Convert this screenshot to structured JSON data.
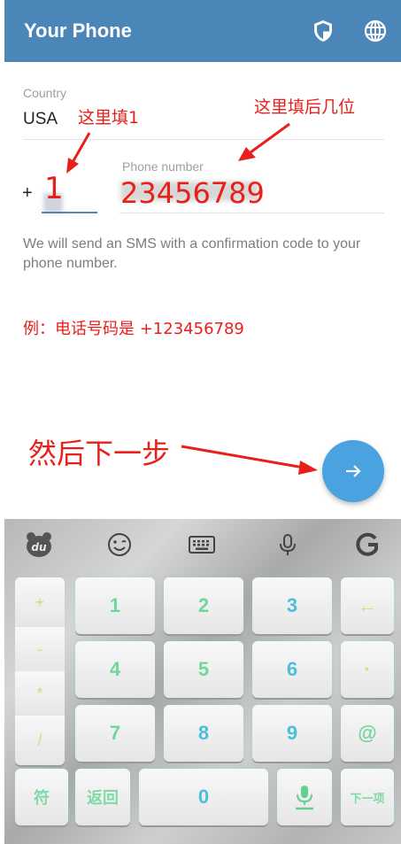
{
  "appbar": {
    "title": "Your Phone",
    "icons": [
      "shield-icon",
      "globe-icon"
    ]
  },
  "form": {
    "country_label": "Country",
    "country_value": "USA",
    "plus": "+",
    "code_value": "1",
    "phone_label": "Phone number",
    "phone_value": "23456789",
    "info": "We will send an SMS with a confirmation code to your phone number."
  },
  "annotations": {
    "fill_code": "这里填1",
    "fill_rest": "这里填后几位",
    "example": "例：电话号码是 +123456789",
    "next_step": "然后下一步"
  },
  "fab": {
    "icon": "arrow-right-icon"
  },
  "keyboard": {
    "toolbar": [
      "du-bear-icon",
      "emoji-icon",
      "keyboard-icon",
      "mic-icon",
      "g-logo-icon"
    ],
    "side_keys": [
      "+",
      "-",
      "*",
      "/"
    ],
    "digits": [
      "1",
      "2",
      "3",
      "4",
      "5",
      "6",
      "7",
      "8",
      "9",
      "0"
    ],
    "backspace": "←",
    "dot": "·",
    "at": "@",
    "symbols": "符",
    "back": "返回",
    "next": "下一项"
  },
  "colors": {
    "appbar": "#4a86b7",
    "annotation_red": "#e8201a",
    "fab": "#4aa3e0"
  }
}
